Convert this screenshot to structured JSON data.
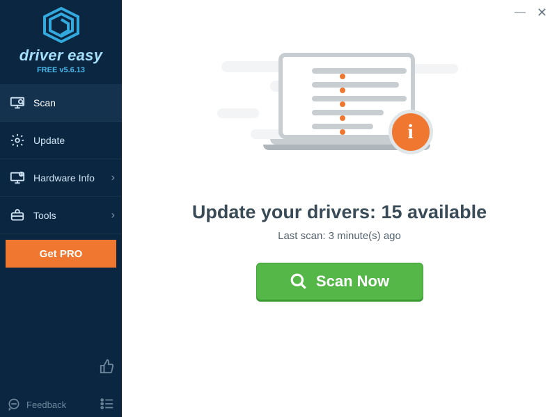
{
  "brand": {
    "name": "driver easy",
    "version_line": "FREE v5.6.13"
  },
  "sidebar": {
    "items": [
      {
        "label": "Scan",
        "active": true
      },
      {
        "label": "Update"
      },
      {
        "label": "Hardware Info",
        "expandable": true
      },
      {
        "label": "Tools",
        "expandable": true
      }
    ],
    "get_pro_label": "Get PRO",
    "feedback_label": "Feedback"
  },
  "main": {
    "headline": "Update your drivers: 15 available",
    "sub": "Last scan: 3 minute(s) ago",
    "scan_button": "Scan Now"
  },
  "window": {
    "minimize": "—",
    "close": "✕"
  }
}
